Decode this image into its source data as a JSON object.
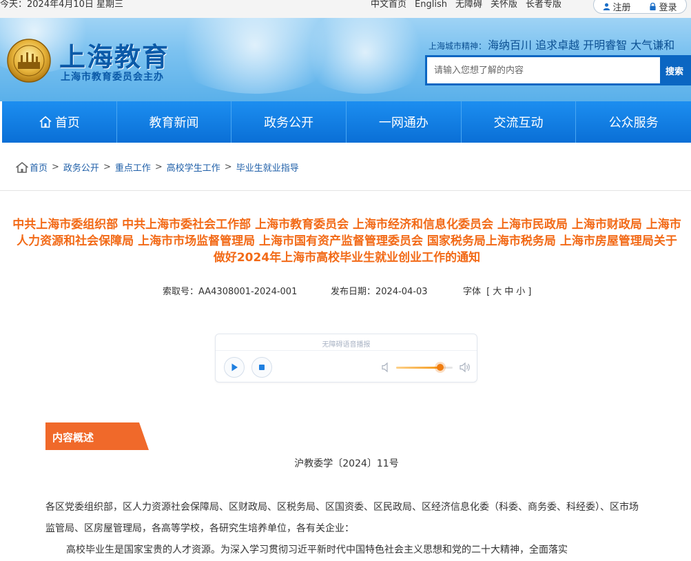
{
  "topbar": {
    "date": "今天：2024年4月10日 星期三",
    "links": [
      "中文首页",
      "English",
      "无障碍",
      "关怀版",
      "长者专版"
    ],
    "register": "注册",
    "login": "登录"
  },
  "header": {
    "title": "上海教育",
    "subtitle": "上海市教育委员会主办",
    "spirit_label": "上海城市精神：",
    "spirit_text": "海纳百川 追求卓越 开明睿智 大气谦和",
    "search_placeholder": "请输入您想了解的内容",
    "search_button": "搜索"
  },
  "nav": {
    "items": [
      "首页",
      "教育新闻",
      "政务公开",
      "一网通办",
      "交流互动",
      "公众服务"
    ]
  },
  "breadcrumb": [
    "首页",
    "政务公开",
    "重点工作",
    "高校学生工作",
    "毕业生就业指导"
  ],
  "article": {
    "title": "中共上海市委组织部 中共上海市委社会工作部 上海市教育委员会 上海市经济和信息化委员会 上海市民政局 上海市财政局 上海市人力资源和社会保障局 上海市市场监督管理局 上海市国有资产监督管理委员会 国家税务局上海市税务局 上海市房屋管理局关于做好2024年上海市高校毕业生就业创业工作的通知",
    "index_label": "索取号：",
    "index_value": "AA4308001-2024-001",
    "date_label": "发布日期：",
    "date_value": "2024-04-03",
    "font_label": "字体",
    "font_open": "[",
    "font_sizes": [
      "大",
      "中",
      "小"
    ],
    "font_close": "]"
  },
  "player": {
    "caption": "无障碍语音播报",
    "volume": 0.78
  },
  "content": {
    "section_label": "内容概述",
    "doc_number": "沪教委学〔2024〕11号",
    "para1": "各区党委组织部，区人力资源社会保障局、区财政局、区税务局、区国资委、区民政局、区经济信息化委（科委、商务委、科经委）、区市场监管局、区房屋管理局，各高等学校，各研究生培养单位，各有关企业：",
    "para2": "高校毕业生是国家宝贵的人才资源。为深入学习贯彻习近平新时代中国特色社会主义思想和党的二十大精神，全面落实"
  },
  "colors": {
    "nav_blue": "#0a6fd6",
    "title_orange": "#f26a17",
    "tab_orange": "#f0692a",
    "brand_blue": "#0b5aa8"
  }
}
